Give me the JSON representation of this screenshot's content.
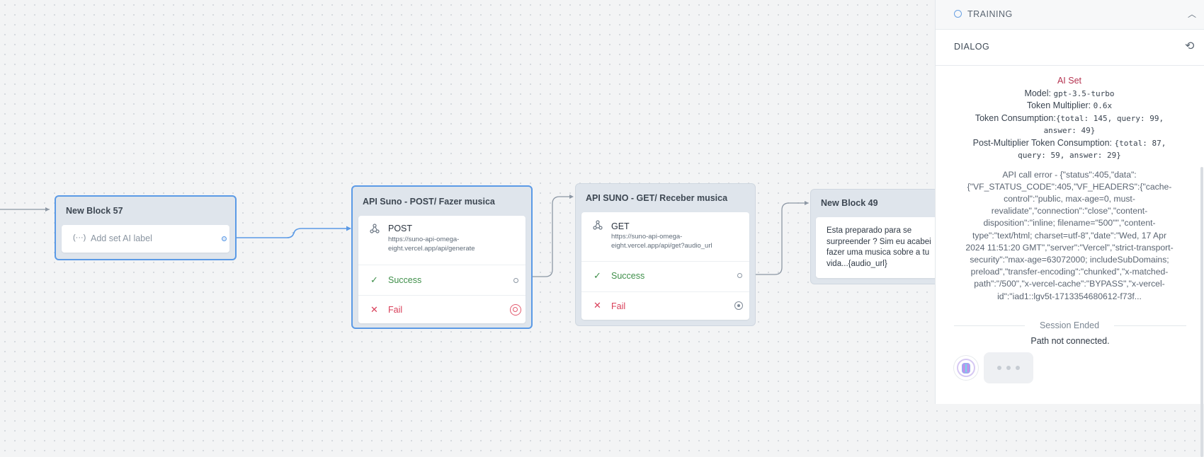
{
  "blocks": {
    "new_block_57": {
      "title": "New Block 57",
      "step_label": "Add set AI label"
    },
    "api_post": {
      "title": "API Suno - POST/ Fazer musica",
      "method": "POST",
      "url_line1": "https://suno-api-omega-",
      "url_line2": "eight.vercel.app/api/generate",
      "success": "Success",
      "fail": "Fail"
    },
    "api_get": {
      "title": "API SUNO - GET/ Receber musica",
      "method": "GET",
      "url_line1": "https://suno-api-omega-",
      "url_line2": "eight.vercel.app/api/get?audio_url",
      "success": "Success",
      "fail": "Fail"
    },
    "new_block_49": {
      "title": "New Block 49",
      "text_line1": "Esta preparado para se",
      "text_line2": "surpreender ? Sim eu acabei",
      "text_line3": "fazer uma musica sobre a tu",
      "text_line4": "vida...{audio_url}"
    }
  },
  "panel": {
    "training_label": "TRAINING",
    "dialog_label": "DIALOG",
    "ai_set": {
      "title": "AI Set",
      "model_label": "Model:",
      "model_value": "gpt-3.5-turbo",
      "multiplier_label": "Token Multiplier:",
      "multiplier_value": "0.6x",
      "consumption_label": "Token Consumption:",
      "consumption_value_a": "{total: 145, query: 99,",
      "consumption_value_b": "answer: 49}",
      "post_label": "Post-Multiplier Token Consumption:",
      "post_value_a": "{total: 87,",
      "post_value_b": "query: 59, answer: 29}"
    },
    "error_lines": [
      "API call error - {\"status\":405,\"data\":",
      "{\"VF_STATUS_CODE\":405,\"VF_HEADERS\":{\"cache-",
      "control\":\"public, max-age=0, must-",
      "revalidate\",\"connection\":\"close\",\"content-",
      "disposition\":\"inline; filename=\"500\"\",\"content-",
      "type\":\"text/html; charset=utf-8\",\"date\":\"Wed, 17 Apr",
      "2024 11:51:20 GMT\",\"server\":\"Vercel\",\"strict-transport-",
      "security\":\"max-age=63072000; includeSubDomains;",
      "preload\",\"transfer-encoding\":\"chunked\",\"x-matched-",
      "path\":\"/500\",\"x-vercel-cache\":\"BYPASS\",\"x-vercel-",
      "id\":\"iad1::lgv5t-1713354680612-f73f..."
    ],
    "session_ended": "Session Ended",
    "path_not_connected": "Path not connected."
  },
  "colors": {
    "accent": "#5b9ae6",
    "success": "#3f8f4a",
    "fail": "#d9405a",
    "ai_set_title": "#b4324f"
  }
}
